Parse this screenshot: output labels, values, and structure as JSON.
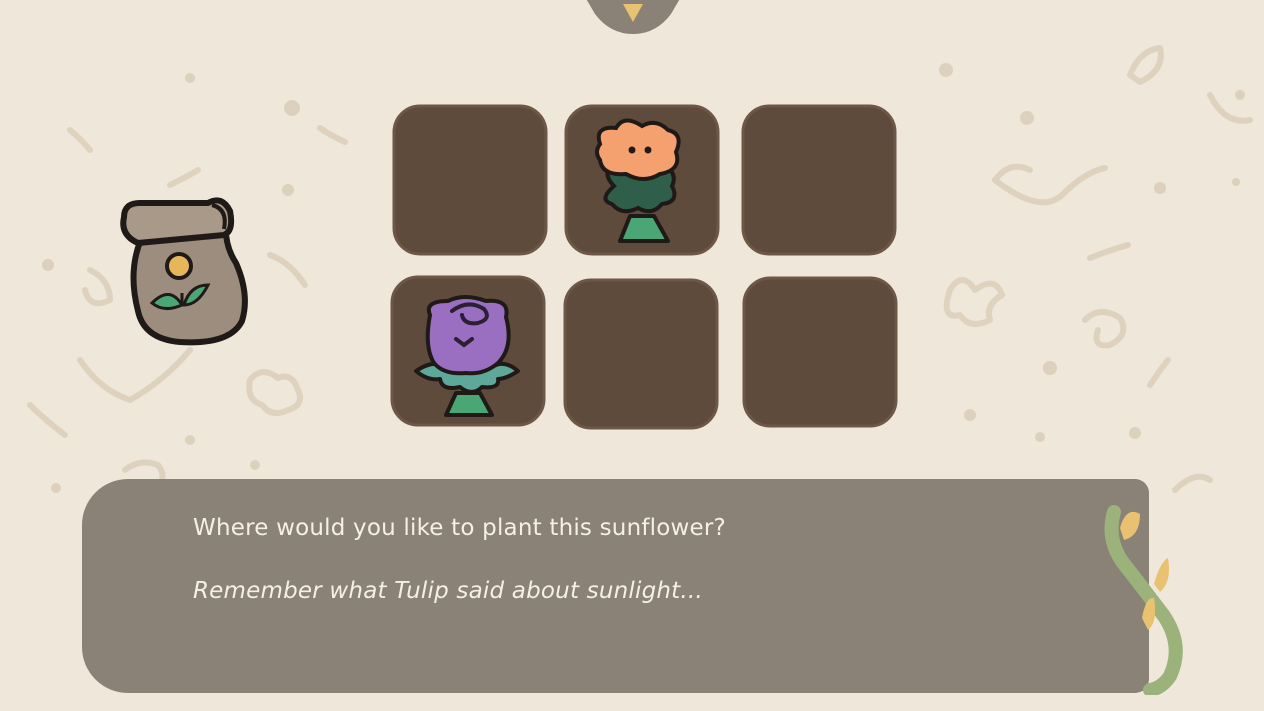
{
  "dialogue": {
    "question": "Where would you like to plant this sunflower?",
    "hint": "Remember what Tulip said about sunlight..."
  },
  "garden": {
    "plots": [
      {
        "slot": 1,
        "plant": "empty"
      },
      {
        "slot": 2,
        "plant": "orange-flower"
      },
      {
        "slot": 3,
        "plant": "empty"
      },
      {
        "slot": 4,
        "plant": "purple-rose"
      },
      {
        "slot": 5,
        "plant": "empty"
      },
      {
        "slot": 6,
        "plant": "empty"
      }
    ]
  },
  "icons": {
    "seed_packet": "seed-packet-icon",
    "menu_tab": "menu-tab-icon"
  },
  "colors": {
    "background": "#efe7da",
    "soil": "#5f4b3b",
    "dialogue_box": "#8a8277",
    "dialogue_text": "#f5efe6",
    "packet": "#9c8d7e",
    "accent_yellow": "#e8b65a",
    "leaf_green": "#4aa675",
    "orange_petal": "#f5a06f",
    "purple_petal": "#9a6fc2"
  }
}
